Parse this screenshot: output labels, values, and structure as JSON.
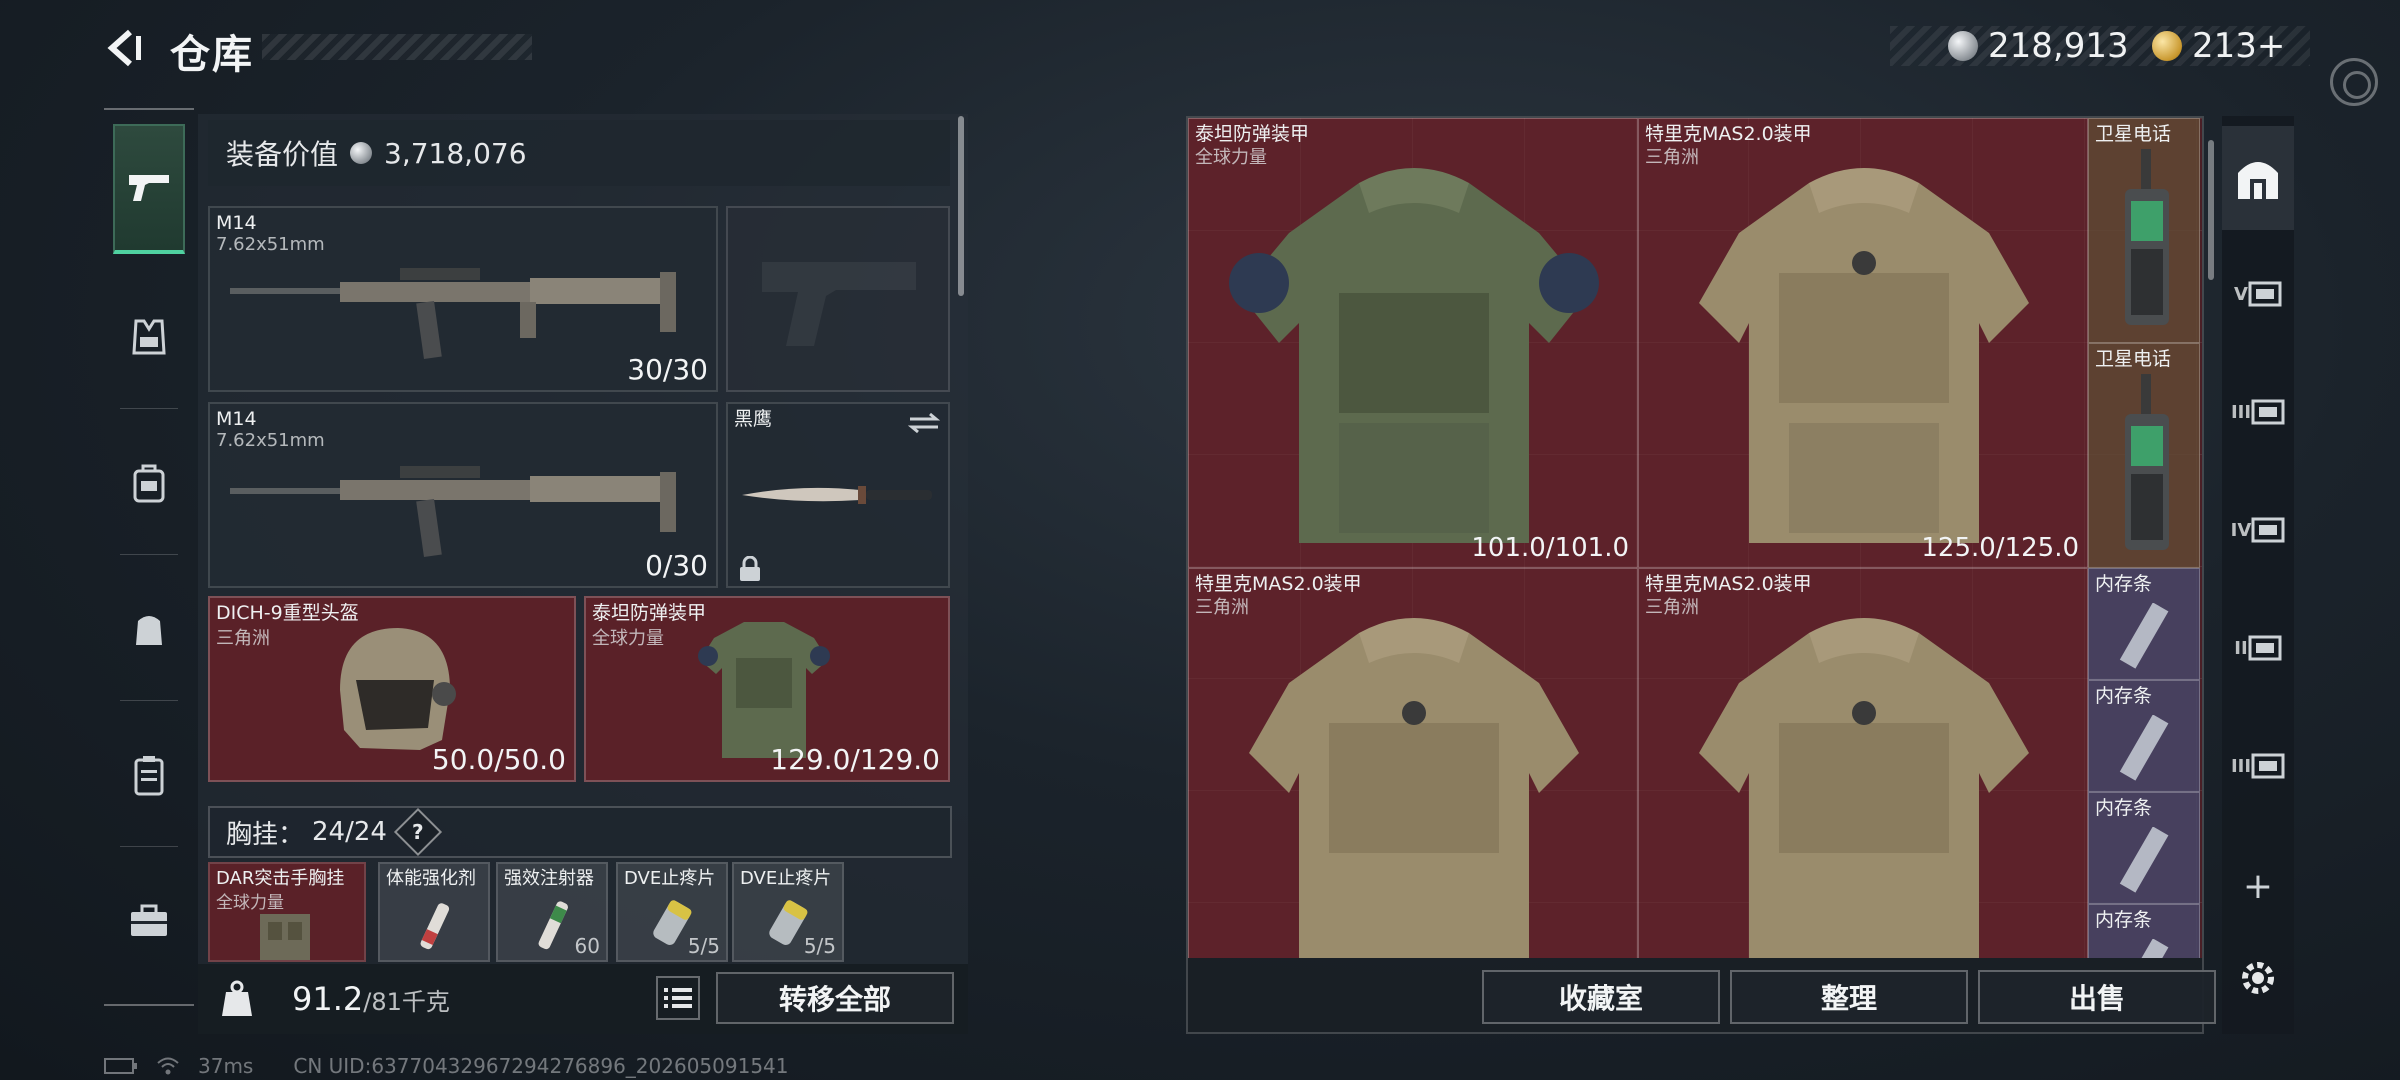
{
  "header": {
    "title": "仓库",
    "currencies": [
      {
        "icon": "silver-coin-icon",
        "amount": "218,913"
      },
      {
        "icon": "gold-coin-icon",
        "amount": "213+"
      }
    ]
  },
  "left_rail": {
    "items": [
      {
        "icon": "pistol-icon",
        "active": true
      },
      {
        "icon": "vest-icon",
        "active": false
      },
      {
        "icon": "backpack-icon",
        "active": false
      },
      {
        "icon": "pouch-icon",
        "active": false
      },
      {
        "icon": "case-icon",
        "active": false
      },
      {
        "icon": "toolbox-icon",
        "active": false
      }
    ]
  },
  "loadout": {
    "value_label": "装备价值",
    "value": "3,718,076",
    "primary_1": {
      "name": "M14",
      "caliber": "7.62x51mm",
      "ammo": "30/30"
    },
    "primary_2": {
      "name": "M14",
      "caliber": "7.62x51mm",
      "ammo": "0/30"
    },
    "melee": {
      "name": "黑鹰"
    },
    "helmet": {
      "name": "DICH-9重型头盔",
      "maker": "三角洲",
      "durability": "50.0/50.0"
    },
    "armor": {
      "name": "泰坦防弹装甲",
      "maker": "全球力量",
      "durability": "129.0/129.0"
    },
    "chest_rig": {
      "label": "胸挂：",
      "capacity": "24/24",
      "help": "?"
    },
    "rig_items": [
      {
        "name": "DAR突击手胸挂",
        "sub": "全球力量",
        "count": ""
      },
      {
        "name": "体能强化剂",
        "sub": "",
        "count": ""
      },
      {
        "name": "强效注射器",
        "sub": "",
        "count": "60"
      },
      {
        "name": "DVE止疼片",
        "sub": "",
        "count": "5/5"
      },
      {
        "name": "DVE止疼片",
        "sub": "",
        "count": "5/5"
      }
    ],
    "weight": {
      "current": "91.2",
      "max": "/81千克"
    },
    "transfer_all": "转移全部"
  },
  "stash": {
    "items": [
      {
        "name": "泰坦防弹装甲",
        "maker": "全球力量",
        "durability": "101.0/101.0"
      },
      {
        "name": "特里克MAS2.0装甲",
        "maker": "三角洲",
        "durability": "125.0/125.0"
      },
      {
        "name": "卫星电话"
      },
      {
        "name": "卫星电话"
      },
      {
        "name": "特里克MAS2.0装甲",
        "maker": "三角洲"
      },
      {
        "name": "特里克MAS2.0装甲",
        "maker": "三角洲"
      },
      {
        "name": "内存条"
      },
      {
        "name": "内存条"
      },
      {
        "name": "内存条"
      },
      {
        "name": "内存条"
      }
    ],
    "buttons": {
      "collection": "收藏室",
      "organize": "整理",
      "sell": "出售"
    },
    "tabs": [
      {
        "icon": "home-tab-icon",
        "label": ""
      },
      {
        "icon": "stash-tab-5-icon",
        "label": "V"
      },
      {
        "icon": "stash-tab-3-icon",
        "label": "III"
      },
      {
        "icon": "stash-tab-4-icon",
        "label": "IV"
      },
      {
        "icon": "stash-tab-2-icon",
        "label": "II"
      },
      {
        "icon": "stash-tab-3b-icon",
        "label": "III"
      }
    ],
    "add_tab": "+"
  },
  "status": {
    "ping": "37ms",
    "uid": "CN UID:6377043296729427689​6_202605091541"
  }
}
